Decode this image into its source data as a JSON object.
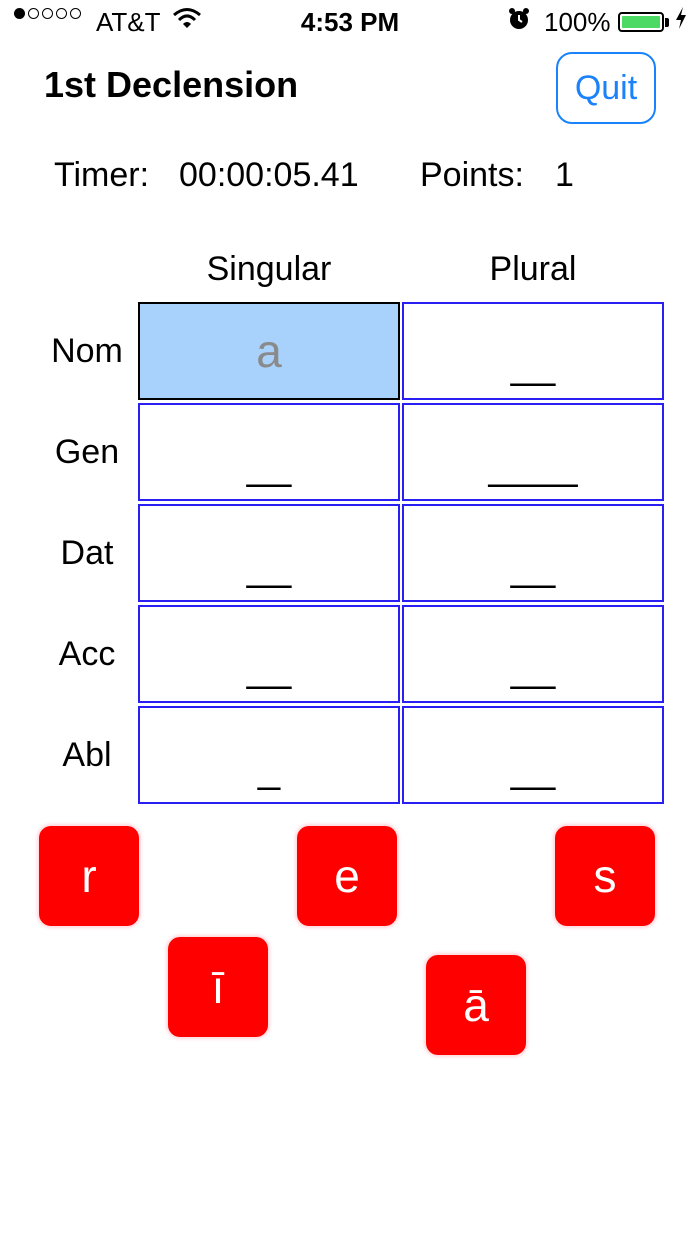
{
  "status_bar": {
    "carrier": "AT&T",
    "time": "4:53 PM",
    "battery": "100%",
    "signal_bars_filled": 1,
    "signal_bars_total": 5
  },
  "header": {
    "title": "1st Declension",
    "quit_label": "Quit"
  },
  "stats": {
    "timer_label": "Timer:",
    "timer_value": "00:00:05.41",
    "points_label": "Points:",
    "points_value": "1"
  },
  "table": {
    "columns": [
      "Singular",
      "Plural"
    ],
    "rows": [
      {
        "case": "Nom",
        "singular": "a",
        "plural": "__"
      },
      {
        "case": "Gen",
        "singular": "__",
        "plural": "____"
      },
      {
        "case": "Dat",
        "singular": "__",
        "plural": "__"
      },
      {
        "case": "Acc",
        "singular": "__",
        "plural": "__"
      },
      {
        "case": "Abl",
        "singular": "_",
        "plural": "__"
      }
    ]
  },
  "tiles": [
    "r",
    "e",
    "s",
    "ī",
    "ā"
  ],
  "colors": {
    "accent": "#1a82fb",
    "cell_border": "#2a1ff2",
    "active_cell": "#a8d2fc",
    "tile": "#ff0000",
    "battery": "#4cd964"
  }
}
